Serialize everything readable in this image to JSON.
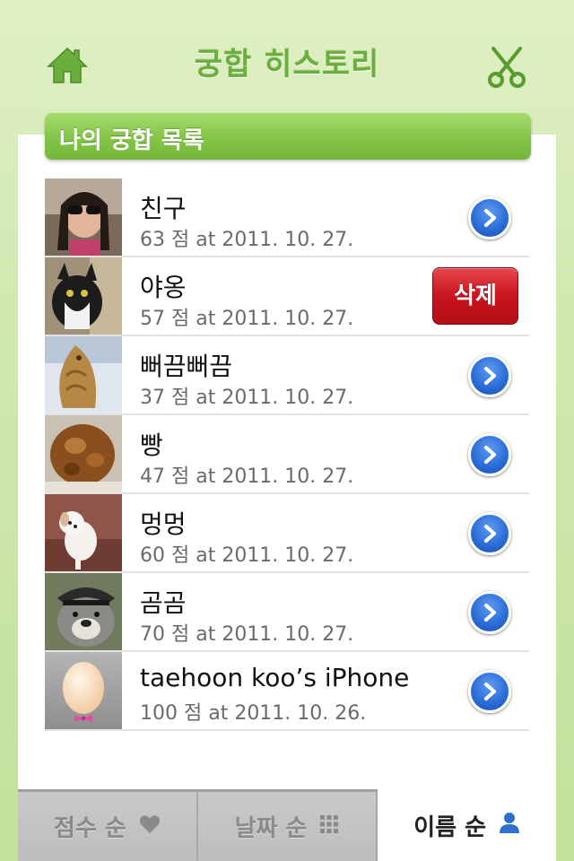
{
  "header": {
    "title": "궁합 히스토리",
    "home_icon": "home-icon",
    "scissors_icon": "scissors-icon",
    "accent_color": "#6cae3e"
  },
  "section": {
    "title": "나의 궁합 목록"
  },
  "list": [
    {
      "name": "친구",
      "meta": "63 점 at 2011. 10. 27.",
      "thumb": "photo-woman-sunglasses",
      "action": "disclosure"
    },
    {
      "name": "야옹",
      "meta": "57 점 at 2011. 10. 27.",
      "thumb": "photo-cat",
      "action": "delete",
      "delete_label": "삭제"
    },
    {
      "name": "뻐끔뻐끔",
      "meta": "37 점 at 2011. 10. 27.",
      "thumb": "photo-fish-bread",
      "action": "disclosure"
    },
    {
      "name": "빵",
      "meta": "47 점 at 2011. 10. 27.",
      "thumb": "photo-bread",
      "action": "disclosure"
    },
    {
      "name": "멍멍",
      "meta": "60 점 at 2011. 10. 27.",
      "thumb": "photo-puppy",
      "action": "disclosure"
    },
    {
      "name": "곰곰",
      "meta": "70 점 at 2011. 10. 27.",
      "thumb": "photo-bear-character",
      "action": "disclosure"
    },
    {
      "name": "taehoon koo’s iPhone",
      "meta": "100 점 at 2011. 10. 26.",
      "thumb": "default-egg-avatar",
      "action": "disclosure"
    }
  ],
  "tabs": [
    {
      "label": "점수 순",
      "icon": "heart-icon",
      "active": false
    },
    {
      "label": "날짜 순",
      "icon": "grid-icon",
      "active": false
    },
    {
      "label": "이름 순",
      "icon": "person-icon",
      "active": true
    }
  ],
  "colors": {
    "delete": "#c9151e",
    "disclosure": "#2a6ad6",
    "header_green": "#86c64a"
  }
}
